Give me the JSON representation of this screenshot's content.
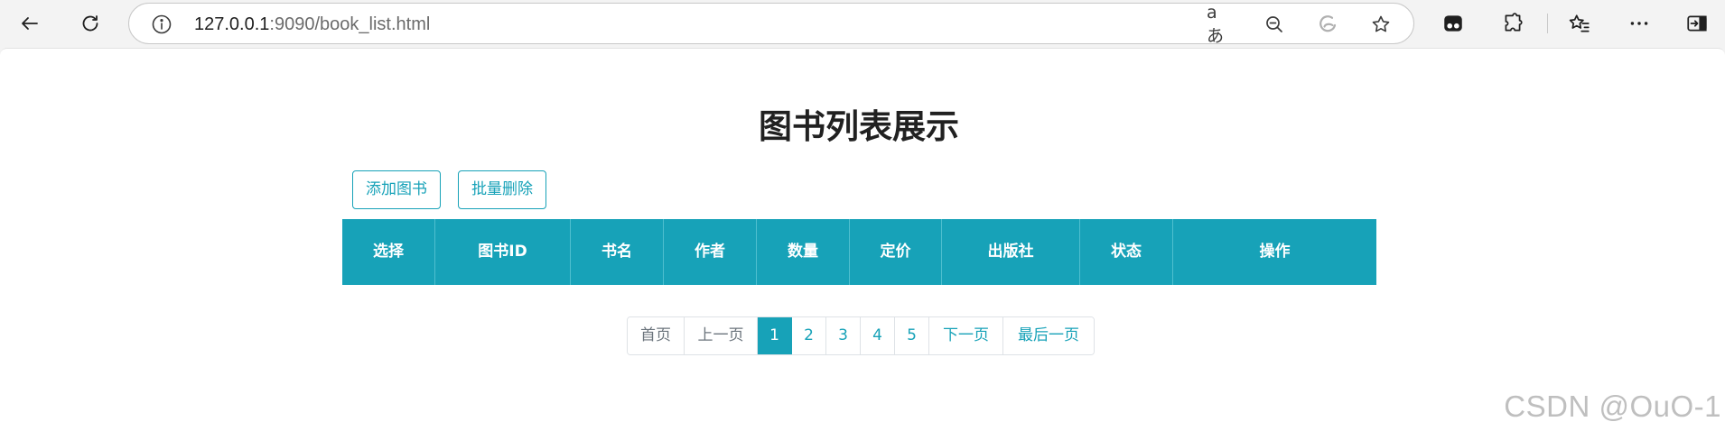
{
  "browser": {
    "url_host": "127.0.0.1",
    "url_path": ":9090/book_list.html",
    "read_aloud_glyph": "aあ"
  },
  "page": {
    "title": "图书列表展示",
    "buttons": {
      "add": "添加图书",
      "batch_delete": "批量删除"
    },
    "table": {
      "headers": [
        "选择",
        "图书ID",
        "书名",
        "作者",
        "数量",
        "定价",
        "出版社",
        "状态",
        "操作"
      ]
    },
    "pagination": {
      "first": "首页",
      "prev": "上一页",
      "pages": [
        "1",
        "2",
        "3",
        "4",
        "5"
      ],
      "current_page": "1",
      "next": "下一页",
      "last": "最后一页"
    },
    "watermark": "CSDN @OuO-1"
  },
  "colors": {
    "accent": "#17a2b8",
    "muted_text": "#6c757d"
  }
}
